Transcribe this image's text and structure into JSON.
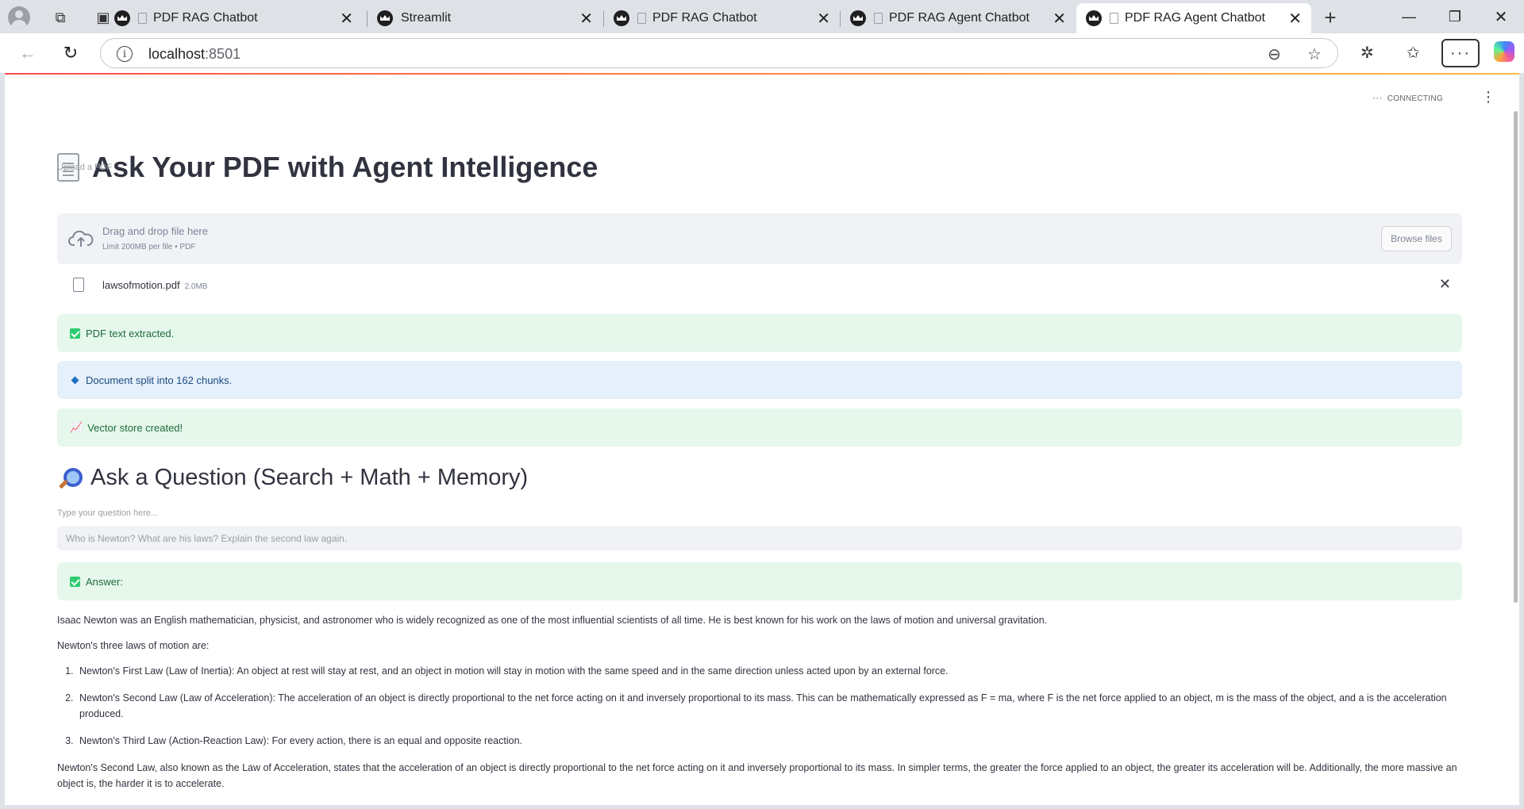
{
  "browser": {
    "tabs": [
      {
        "title": "PDF RAG Chatbot",
        "active": false
      },
      {
        "title": "Streamlit",
        "active": false
      },
      {
        "title": "PDF RAG Chatbot",
        "active": false
      },
      {
        "title": "PDF RAG Agent Chatbot",
        "active": false
      },
      {
        "title": "PDF RAG Agent Chatbot",
        "active": true
      }
    ],
    "url_host": "localhost",
    "url_port": ":8501"
  },
  "app": {
    "status": "CONNECTING",
    "title": "Ask Your PDF with Agent Intelligence",
    "upload": {
      "label": "Upload a PDF",
      "drop_text": "Drag and drop file here",
      "limit_text": "Limit 200MB per file • PDF",
      "browse_label": "Browse files"
    },
    "file": {
      "name": "lawsofmotion.pdf",
      "size": "2.0MB"
    },
    "alerts": {
      "extracted": "PDF text extracted.",
      "split": "Document split into 162 chunks.",
      "vector": "Vector store created!"
    },
    "question_header": "Ask a Question (Search + Math + Memory)",
    "question": {
      "label": "Type your question here...",
      "placeholder": "Who is Newton? What are his laws? Explain the second law again."
    },
    "answer_label": "Answer:",
    "answer": {
      "intro": "Isaac Newton was an English mathematician, physicist, and astronomer who is widely recognized as one of the most influential scientists of all time. He is best known for his work on the laws of motion and universal gravitation.",
      "laws_intro": "Newton's three laws of motion are:",
      "laws": [
        "Newton's First Law (Law of Inertia): An object at rest will stay at rest, and an object in motion will stay in motion with the same speed and in the same direction unless acted upon by an external force.",
        "Newton's Second Law (Law of Acceleration): The acceleration of an object is directly proportional to the net force acting on it and inversely proportional to its mass. This can be mathematically expressed as F = ma, where F is the net force applied to an object, m is the mass of the object, and a is the acceleration produced.",
        "Newton's Third Law (Action-Reaction Law): For every action, there is an equal and opposite reaction."
      ],
      "second_law": "Newton's Second Law, also known as the Law of Acceleration, states that the acceleration of an object is directly proportional to the net force acting on it and inversely proportional to its mass. In simpler terms, the greater the force applied to an object, the greater its acceleration will be. Additionally, the more massive an object is, the harder it is to accelerate."
    }
  }
}
